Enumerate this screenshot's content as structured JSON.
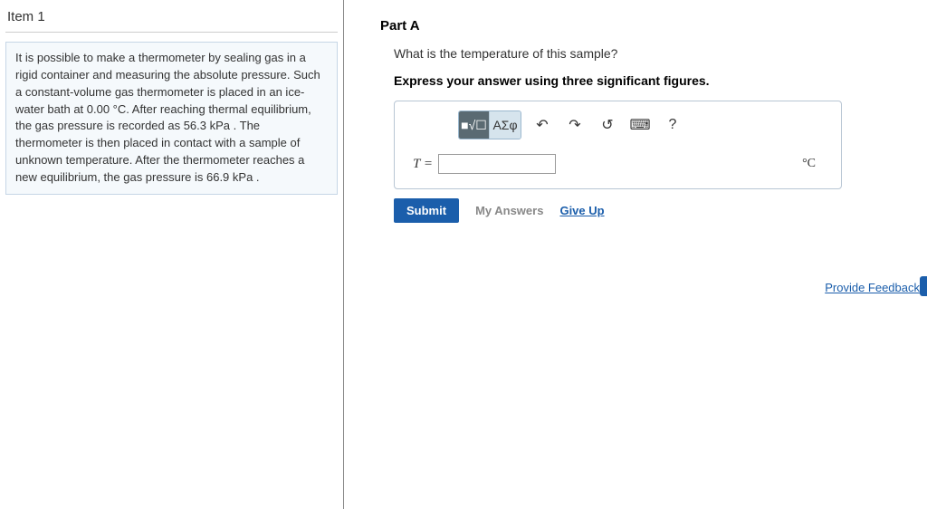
{
  "left": {
    "item_header": "Item 1",
    "problem_text": "It is possible to make a thermometer by sealing gas in a rigid container and measuring the absolute pressure. Such a constant-volume gas thermometer is placed in an ice-water bath at 0.00 °C. After reaching thermal equilibrium, the gas pressure is recorded as 56.3 kPa . The thermometer is then placed in contact with a sample of unknown temperature. After the thermometer reaches a new equilibrium, the gas pressure is 66.9 kPa ."
  },
  "right": {
    "part_label": "Part A",
    "question": "What is the temperature of this sample?",
    "instruction": "Express your answer using three significant figures.",
    "toolbar": {
      "templates_icon": "■√☐",
      "greek_label": "ΑΣφ",
      "undo_icon": "↶",
      "redo_icon": "↷",
      "reset_icon": "↺",
      "keyboard_icon": "⌨",
      "help_icon": "?"
    },
    "answer": {
      "variable": "T =",
      "value": "",
      "unit": "°C"
    },
    "buttons": {
      "submit": "Submit",
      "my_answers": "My Answers",
      "give_up": "Give Up"
    },
    "feedback": "Provide Feedback"
  }
}
